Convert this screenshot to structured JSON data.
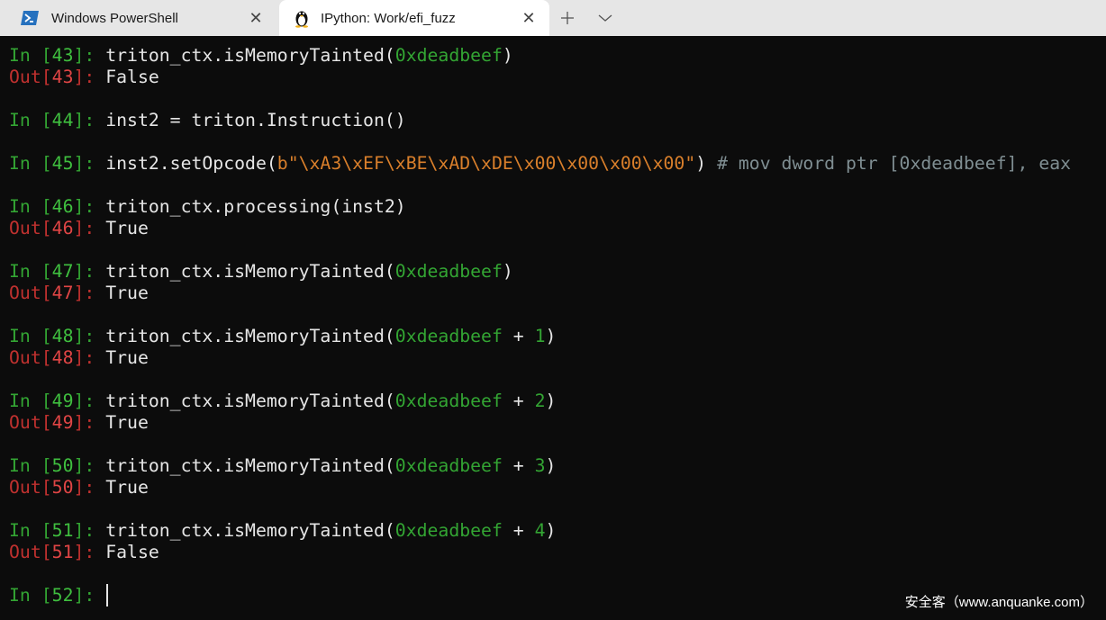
{
  "tabs": [
    {
      "title": "Windows PowerShell",
      "icon": "powershell-icon",
      "active": false
    },
    {
      "title": "IPython: Work/efi_fuzz",
      "icon": "tux-linux-icon",
      "active": true
    }
  ],
  "colors": {
    "prompt_in": "#33a533",
    "prompt_out": "#c0312f",
    "string": "#d97f2b",
    "comment": "#7f8e92",
    "text": "#e6e6e6",
    "background": "#0c0c0c"
  },
  "cells": {
    "c43": {
      "in_no": "43",
      "code_a": "triton_ctx.isMemoryTainted(",
      "arg": "0xdeadbeef",
      "code_b": ")",
      "out": "False"
    },
    "c44": {
      "in_no": "44",
      "code": "inst2 = triton.Instruction()"
    },
    "c45": {
      "in_no": "45",
      "code_a": "inst2.setOpcode(",
      "string": "b\"\\xA3\\xEF\\xBE\\xAD\\xDE\\x00\\x00\\x00\\x00\"",
      "code_b": ") ",
      "comment": "# mov dword ptr [0xdeadbeef], eax"
    },
    "c46": {
      "in_no": "46",
      "code": "triton_ctx.processing(inst2)",
      "out": "True"
    },
    "c47": {
      "in_no": "47",
      "code_a": "triton_ctx.isMemoryTainted(",
      "arg": "0xdeadbeef",
      "code_b": ")",
      "out": "True"
    },
    "c48": {
      "in_no": "48",
      "code_a": "triton_ctx.isMemoryTainted(",
      "arg": "0xdeadbeef",
      "op": " + ",
      "num": "1",
      "code_b": ")",
      "out": "True"
    },
    "c49": {
      "in_no": "49",
      "code_a": "triton_ctx.isMemoryTainted(",
      "arg": "0xdeadbeef",
      "op": " + ",
      "num": "2",
      "code_b": ")",
      "out": "True"
    },
    "c50": {
      "in_no": "50",
      "code_a": "triton_ctx.isMemoryTainted(",
      "arg": "0xdeadbeef",
      "op": " + ",
      "num": "3",
      "code_b": ")",
      "out": "True"
    },
    "c51": {
      "in_no": "51",
      "code_a": "triton_ctx.isMemoryTainted(",
      "arg": "0xdeadbeef",
      "op": " + ",
      "num": "4",
      "code_b": ")",
      "out": "False"
    },
    "c52": {
      "in_no": "52"
    }
  },
  "prompt": {
    "in_label": "In ",
    "out_label": "Out",
    "open": "[",
    "close": "]: "
  },
  "watermark": "安全客（www.anquanke.com）"
}
